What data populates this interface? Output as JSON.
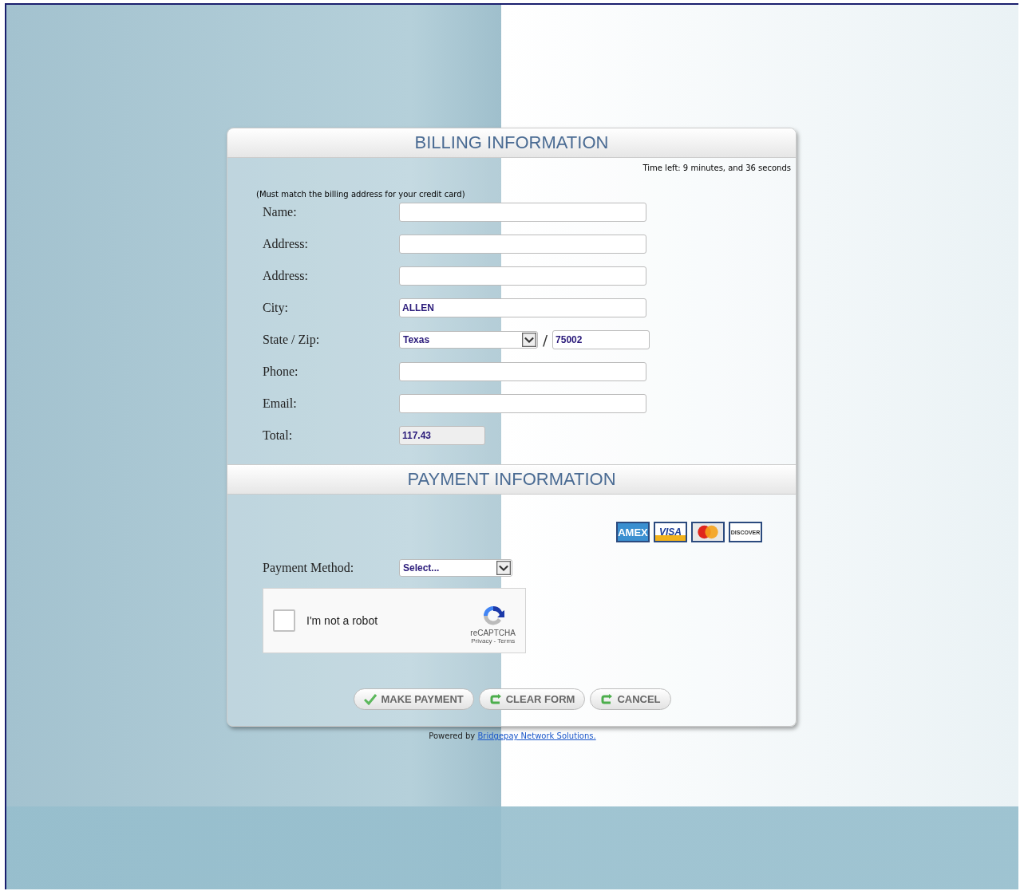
{
  "billing": {
    "title": "BILLING INFORMATION",
    "timer": "Time left: 9 minutes, and 36 seconds",
    "note": "(Must match the billing address for your credit card)",
    "fields": [
      {
        "label": "Name:",
        "kind": "text"
      },
      {
        "label": "Address:",
        "kind": "text"
      },
      {
        "label": "Address:",
        "kind": "text"
      },
      {
        "label": "City:",
        "kind": "text",
        "value": "ALLEN"
      },
      {
        "label": "State / Zip:",
        "kind": "statezip",
        "value": "Texas",
        "separator": "/",
        "zip": "75002"
      },
      {
        "label": "Phone:",
        "kind": "text"
      },
      {
        "label": "Email:",
        "kind": "text"
      },
      {
        "label": "Total:",
        "kind": "readonly",
        "value": "117.43"
      }
    ]
  },
  "payment": {
    "title": "PAYMENT INFORMATION",
    "cards": [
      {
        "kind": "amex",
        "label": "AMEX"
      },
      {
        "kind": "visa",
        "label": "VISA"
      },
      {
        "kind": "mastercard"
      },
      {
        "kind": "discover",
        "label": "DISCOVER"
      }
    ],
    "method_label": "Payment Method:",
    "method_value": "Select...",
    "captcha": {
      "label": "I'm not a robot",
      "checked": false,
      "brand": "reCAPTCHA",
      "links": "Privacy - Terms"
    },
    "buttons": [
      {
        "kind": "check",
        "label": "MAKE PAYMENT"
      },
      {
        "kind": "reset",
        "label": "CLEAR FORM"
      },
      {
        "kind": "reset",
        "label": "CANCEL"
      }
    ]
  },
  "footer": {
    "text": "Powered by",
    "link": "Bridgepay Network Solutions."
  }
}
